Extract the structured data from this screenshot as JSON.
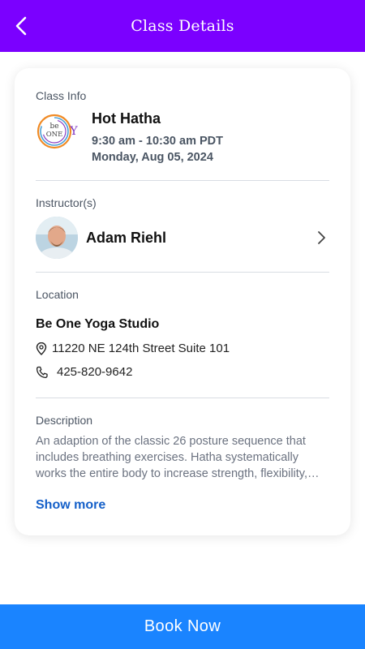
{
  "header": {
    "title": "Class Details",
    "background_color": "#7b00ff",
    "back_icon": "chevron-left-icon"
  },
  "class_info": {
    "label": "Class Info",
    "logo_text_top": "be",
    "logo_text_bottom": "ONE",
    "logo_letter": "Y",
    "name": "Hot Hatha",
    "time": "9:30 am - 10:30 am PDT",
    "date": "Monday, Aug 05, 2024"
  },
  "instructors": {
    "label": "Instructor(s)",
    "items": [
      {
        "name": "Adam Riehl",
        "icon": "chevron-right-icon"
      }
    ]
  },
  "location": {
    "label": "Location",
    "studio": "Be One Yoga Studio",
    "address": "11220 NE 124th Street Suite 101",
    "phone": "425-820-9642",
    "address_icon": "map-pin-icon",
    "phone_icon": "phone-icon"
  },
  "description": {
    "label": "Description",
    "text": "An adaption of the classic 26 posture sequence that includes breathing exercises. Hatha systematically works the entire body to increase strength, flexibility, and balance.",
    "show_more": "Show more"
  },
  "footer": {
    "book_label": "Book Now",
    "button_color": "#1a84ff"
  }
}
